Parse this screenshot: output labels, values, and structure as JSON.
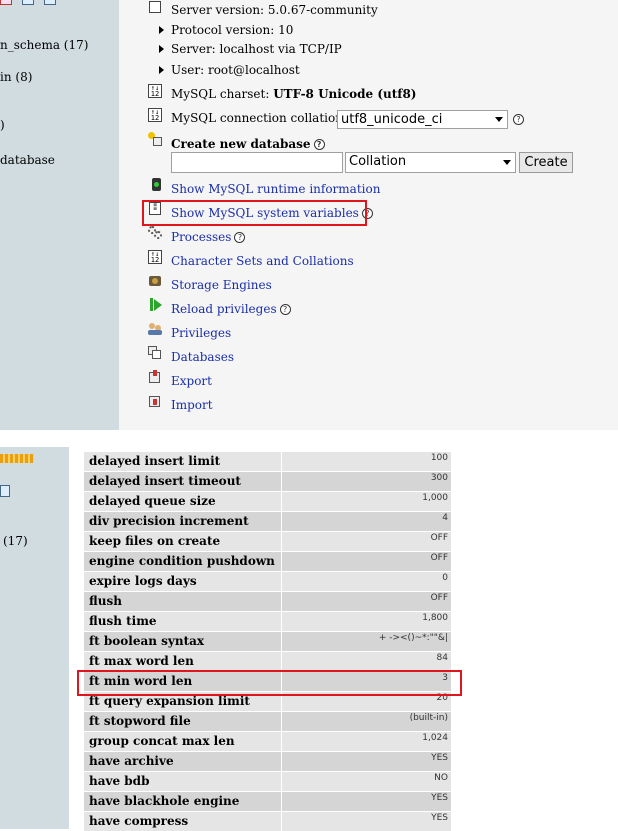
{
  "top_sidebar": {
    "items": [
      "n_schema (17)",
      "in (8)",
      ")",
      "database"
    ]
  },
  "server_info": {
    "server_version": "Server version: 5.0.67-community",
    "protocol_version": "Protocol version: 10",
    "server": "Server: localhost via TCP/IP",
    "user": "User: root@localhost"
  },
  "charset": {
    "label": "MySQL charset: ",
    "value": "UTF-8 Unicode (utf8)"
  },
  "collation": {
    "label": "MySQL connection collation: ",
    "selected": "utf8_unicode_ci"
  },
  "create_db": {
    "title": "Create new database",
    "collation_placeholder": "Collation",
    "button": "Create"
  },
  "links": {
    "runtime_info": "Show MySQL runtime information",
    "system_variables": "Show MySQL system variables",
    "processes": "Processes",
    "charsets": "Character Sets and Collations",
    "engines": "Storage Engines",
    "reload": "Reload privileges",
    "privileges": "Privileges",
    "databases": "Databases",
    "export": "Export",
    "import": "Import"
  },
  "help_glyph": "?",
  "bottom_sidebar": {
    "items": [
      "(17)"
    ]
  },
  "variables": [
    {
      "name": "delayed insert limit",
      "value": "100"
    },
    {
      "name": "delayed insert timeout",
      "value": "300"
    },
    {
      "name": "delayed queue size",
      "value": "1,000"
    },
    {
      "name": "div precision increment",
      "value": "4"
    },
    {
      "name": "keep files on create",
      "value": "OFF"
    },
    {
      "name": "engine condition pushdown",
      "value": "OFF"
    },
    {
      "name": "expire logs days",
      "value": "0"
    },
    {
      "name": "flush",
      "value": "OFF"
    },
    {
      "name": "flush time",
      "value": "1,800"
    },
    {
      "name": "ft boolean syntax",
      "value": "+ -><()~*:\"\"&|"
    },
    {
      "name": "ft max word len",
      "value": "84"
    },
    {
      "name": "ft min word len",
      "value": "3"
    },
    {
      "name": "ft query expansion limit",
      "value": "20"
    },
    {
      "name": "ft stopword file",
      "value": "(built-in)"
    },
    {
      "name": "group concat max len",
      "value": "1,024"
    },
    {
      "name": "have archive",
      "value": "YES"
    },
    {
      "name": "have bdb",
      "value": "NO"
    },
    {
      "name": "have blackhole engine",
      "value": "YES"
    },
    {
      "name": "have compress",
      "value": "YES"
    }
  ],
  "colors": {
    "highlight": "#e0161e",
    "link": "#1a2ea8",
    "sidebar": "#d0dce0"
  },
  "icons": {
    "server": "server-icon",
    "charset": "charset-icon",
    "create_db": "new-database-icon",
    "runtime": "traffic-light-icon",
    "variables": "document-icon",
    "processes": "gears-icon",
    "engines": "engine-icon",
    "reload": "reload-icon",
    "privileges": "users-icon",
    "databases": "databases-icon",
    "export": "export-icon",
    "import": "import-icon"
  }
}
